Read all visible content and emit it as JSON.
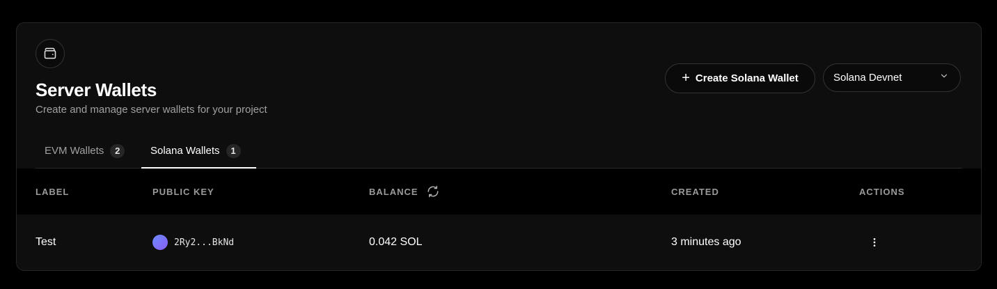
{
  "header": {
    "icon": "wallet-icon",
    "title": "Server Wallets",
    "subtitle": "Create and manage server wallets for your project"
  },
  "actions": {
    "create_button_label": "Create Solana Wallet",
    "create_button_icon": "plus-icon",
    "network_selected": "Solana Devnet",
    "network_icon": "chevron-down-icon"
  },
  "tabs": [
    {
      "label": "EVM Wallets",
      "count": "2",
      "active": false
    },
    {
      "label": "Solana Wallets",
      "count": "1",
      "active": true
    }
  ],
  "table": {
    "columns": [
      "LABEL",
      "PUBLIC KEY",
      "BALANCE",
      "CREATED",
      "ACTIONS"
    ],
    "balance_refresh_icon": "refresh-icon",
    "rows": [
      {
        "label": "Test",
        "public_key": "2Ry2...BkNd",
        "balance": "0.042 SOL",
        "created": "3 minutes ago",
        "actions_icon": "more-vertical-icon"
      }
    ]
  },
  "colors": {
    "background": "#000000",
    "card": "#0e0e0e",
    "border": "#262626",
    "muted_text": "#a1a1a1",
    "avatar_gradient_start": "#6b8cff",
    "avatar_gradient_end": "#8a5cf5"
  }
}
